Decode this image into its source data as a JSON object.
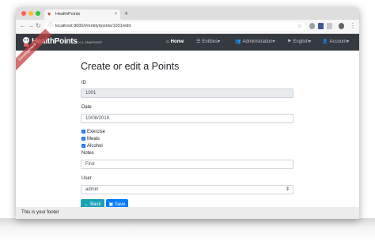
{
  "browser": {
    "tab_title": "HealthPoints",
    "tab_close": "×",
    "new_tab": "+",
    "url": "localhost:9000/#/entity/points/1001/edit"
  },
  "navbar": {
    "brand": "HealthPoints",
    "version": "0.0.1-SNAPSHOT",
    "ribbon": "Development",
    "items": [
      {
        "label": "Home",
        "icon": "home-icon",
        "glyph": "⌂"
      },
      {
        "label": "Entities",
        "icon": "list-icon",
        "glyph": "☰"
      },
      {
        "label": "Administration",
        "icon": "users-icon",
        "glyph": "👥"
      },
      {
        "label": "English",
        "icon": "flag-icon",
        "glyph": "⚑"
      },
      {
        "label": "Account",
        "icon": "user-icon",
        "glyph": "👤"
      }
    ]
  },
  "form": {
    "title": "Create or edit a Points",
    "id_label": "ID",
    "id_value": "1001",
    "date_label": "Date",
    "date_value": "10/08/2018",
    "checkboxes": [
      {
        "label": "Exercise",
        "checked": true
      },
      {
        "label": "Meals",
        "checked": true
      },
      {
        "label": "Alcohol",
        "checked": true
      }
    ],
    "notes_label": "Notes",
    "notes_value": "First",
    "user_label": "User",
    "user_value": "admin",
    "back_label": "Back",
    "save_label": "Save"
  },
  "footer": {
    "text": "This is your footer"
  },
  "colors": {
    "navbar": "#353a40",
    "back_button": "#17a2b8",
    "save_button": "#007bff",
    "ribbon": "#c44040"
  }
}
